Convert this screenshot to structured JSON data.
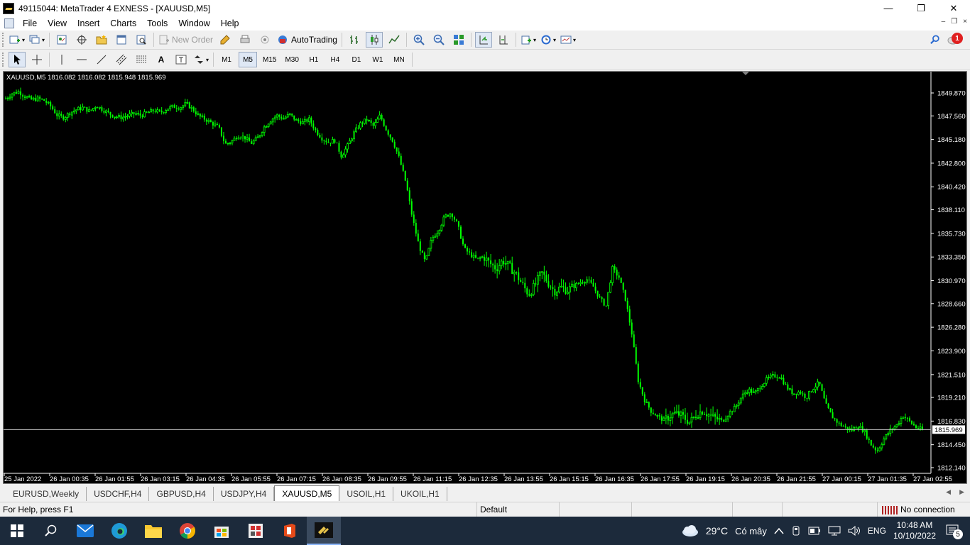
{
  "window": {
    "title": "49115044: MetaTrader 4 EXNESS - [XAUUSD,M5]",
    "controls": [
      "—",
      "❐",
      "✕"
    ]
  },
  "menu": {
    "items": [
      "File",
      "View",
      "Insert",
      "Charts",
      "Tools",
      "Window",
      "Help"
    ],
    "mdi_controls": [
      "–",
      "❐",
      "×"
    ]
  },
  "toolbar": {
    "new_order_label": "New Order",
    "autotrading_label": "AutoTrading",
    "notification_count": "1"
  },
  "timeframes": {
    "items": [
      "M1",
      "M5",
      "M15",
      "M30",
      "H1",
      "H4",
      "D1",
      "W1",
      "MN"
    ],
    "active": "M5"
  },
  "chart": {
    "header": "XAUUSD,M5  1816.082 1816.082 1815.948 1815.969",
    "current_price": "1815.969",
    "bullish_color": "#00ff00",
    "background": "#000000",
    "price_line_color": "#c0c0c0"
  },
  "chart_data": {
    "type": "candlestick",
    "symbol": "XAUUSD",
    "timeframe": "M5",
    "ylim": [
      1812.14,
      1851.0
    ],
    "y_ticks": [
      "1849.870",
      "1847.560",
      "1845.180",
      "1842.800",
      "1840.420",
      "1838.110",
      "1835.730",
      "1833.350",
      "1830.970",
      "1828.660",
      "1826.280",
      "1823.900",
      "1821.510",
      "1819.210",
      "1816.830",
      "1814.450",
      "1812.140"
    ],
    "y_tick_values": [
      1849.87,
      1847.56,
      1845.18,
      1842.8,
      1840.42,
      1838.11,
      1835.73,
      1833.35,
      1830.97,
      1828.66,
      1826.28,
      1823.9,
      1821.51,
      1819.21,
      1816.83,
      1814.45,
      1812.14
    ],
    "x_ticks": [
      "25 Jan 2022",
      "26 Jan 00:35",
      "26 Jan 01:55",
      "26 Jan 03:15",
      "26 Jan 04:35",
      "26 Jan 05:55",
      "26 Jan 07:15",
      "26 Jan 08:35",
      "26 Jan 09:55",
      "26 Jan 11:15",
      "26 Jan 12:35",
      "26 Jan 13:55",
      "26 Jan 15:15",
      "26 Jan 16:35",
      "26 Jan 17:55",
      "26 Jan 19:15",
      "26 Jan 20:35",
      "26 Jan 21:55",
      "27 Jan 00:15",
      "27 Jan 01:35",
      "27 Jan 02:55"
    ],
    "close_path": [
      1849.3,
      1849.8,
      1850.0,
      1849.5,
      1849.2,
      1849.3,
      1849.1,
      1848.5,
      1847.6,
      1847.4,
      1847.9,
      1848.2,
      1848.4,
      1848.0,
      1848.6,
      1848.2,
      1847.8,
      1847.5,
      1847.4,
      1847.6,
      1847.8,
      1847.6,
      1847.9,
      1848.1,
      1847.9,
      1848.3,
      1848.5,
      1848.4,
      1848.8,
      1848.2,
      1847.5,
      1847.2,
      1846.8,
      1846.4,
      1844.7,
      1845.0,
      1845.6,
      1845.4,
      1844.8,
      1845.3,
      1846.4,
      1847.1,
      1847.6,
      1847.3,
      1847.7,
      1847.1,
      1846.9,
      1847.2,
      1846.1,
      1845.3,
      1844.9,
      1845.1,
      1843.5,
      1844.6,
      1845.9,
      1846.8,
      1847.2,
      1846.5,
      1847.6,
      1846.1,
      1845.0,
      1843.2,
      1840.8,
      1837.3,
      1834.5,
      1832.8,
      1835.2,
      1836.0,
      1837.4,
      1837.8,
      1836.6,
      1834.2,
      1833.6,
      1833.1,
      1833.4,
      1832.7,
      1832.2,
      1833.0,
      1832.4,
      1831.7,
      1830.6,
      1829.6,
      1830.5,
      1831.8,
      1830.8,
      1829.9,
      1830.3,
      1830.0,
      1830.4,
      1830.8,
      1831.1,
      1830.4,
      1829.2,
      1828.4,
      1832.2,
      1831.3,
      1829.1,
      1825.6,
      1820.8,
      1818.9,
      1817.8,
      1817.3,
      1816.9,
      1817.4,
      1817.6,
      1817.2,
      1816.7,
      1817.5,
      1817.9,
      1817.4,
      1817.1,
      1816.8,
      1817.6,
      1818.2,
      1819.3,
      1820.0,
      1819.6,
      1820.4,
      1821.1,
      1821.4,
      1821.3,
      1820.2,
      1819.6,
      1819.8,
      1819.2,
      1820.1,
      1820.7,
      1818.5,
      1817.3,
      1816.6,
      1816.2,
      1815.9,
      1816.4,
      1815.8,
      1814.5,
      1813.8,
      1815.0,
      1815.9,
      1816.4,
      1817.4,
      1816.8,
      1816.2,
      1815.97
    ]
  },
  "tabs": {
    "items": [
      "EURUSD,Weekly",
      "USDCHF,H4",
      "GBPUSD,H4",
      "USDJPY,H4",
      "XAUUSD,M5",
      "USOIL,H1",
      "UKOIL,H1"
    ],
    "active": "XAUUSD,M5",
    "arrows": [
      "◀",
      "▶"
    ]
  },
  "status": {
    "help": "For Help, press F1",
    "profile": "Default",
    "connection": "No connection"
  },
  "taskbar": {
    "weather_temp": "29°C",
    "weather_text": "Có mây",
    "language": "ENG",
    "time": "10:48 AM",
    "date": "10/10/2022",
    "notifications": "5"
  }
}
